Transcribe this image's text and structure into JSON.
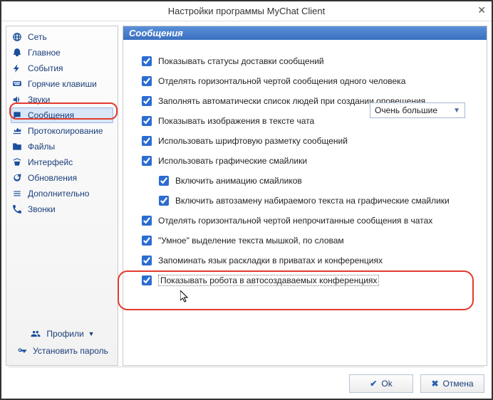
{
  "window": {
    "title": "Настройки программы MyChat Client"
  },
  "sidebar": {
    "items": [
      {
        "label": "Сеть",
        "selected": false
      },
      {
        "label": "Главное",
        "selected": false
      },
      {
        "label": "События",
        "selected": false
      },
      {
        "label": "Горячие клавиши",
        "selected": false
      },
      {
        "label": "Звуки",
        "selected": false
      },
      {
        "label": "Сообщения",
        "selected": true
      },
      {
        "label": "Протоколирование",
        "selected": false
      },
      {
        "label": "Файлы",
        "selected": false
      },
      {
        "label": "Интерфейс",
        "selected": false
      },
      {
        "label": "Обновления",
        "selected": false
      },
      {
        "label": "Дополнительно",
        "selected": false
      },
      {
        "label": "Звонки",
        "selected": false
      }
    ],
    "profiles_label": "Профили",
    "set_password_label": "Установить пароль"
  },
  "panel": {
    "title": "Сообщения",
    "options": [
      {
        "label": "Показывать статусы доставки сообщений",
        "checked": true,
        "indent": 0
      },
      {
        "label": "Отделять горизонтальной чертой сообщения одного человека",
        "checked": true,
        "indent": 0
      },
      {
        "label": "Заполнять автоматически список людей при создании оповещения",
        "checked": true,
        "indent": 0
      },
      {
        "label": "Показывать изображения в тексте чата",
        "checked": true,
        "indent": 0,
        "combo": true
      },
      {
        "label": "Использовать шрифтовую разметку сообщений",
        "checked": true,
        "indent": 0
      },
      {
        "label": "Использовать графические смайлики",
        "checked": true,
        "indent": 0
      },
      {
        "label": "Включить анимацию смайликов",
        "checked": true,
        "indent": 1
      },
      {
        "label": "Включить автозамену набираемого текста на графические смайлики",
        "checked": true,
        "indent": 1
      },
      {
        "label": "Отделять горизонтальной чертой непрочитанные сообщения в чатах",
        "checked": true,
        "indent": 0
      },
      {
        "label": "\"Умное\" выделение текста мышкой, по словам",
        "checked": true,
        "indent": 0
      },
      {
        "label": "Запоминать язык раскладки в приватах и конференциях",
        "checked": true,
        "indent": 0
      },
      {
        "label": "Показывать робота в автосоздаваемых конференциях",
        "checked": true,
        "indent": 0,
        "focused": true
      }
    ],
    "image_size_value": "Очень большие"
  },
  "footer": {
    "ok": "Ok",
    "cancel": "Отмена"
  }
}
